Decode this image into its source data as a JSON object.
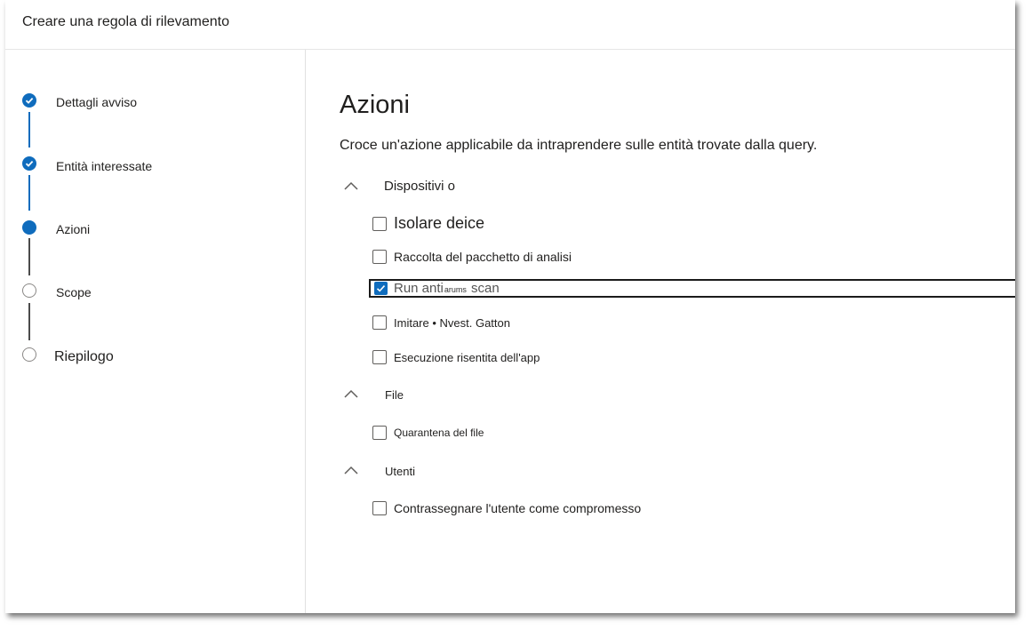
{
  "header": {
    "title": "Creare una regola di rilevamento"
  },
  "steps": [
    {
      "label": "Dettagli avviso",
      "state": "done"
    },
    {
      "label": "Entità interessate",
      "state": "done"
    },
    {
      "label": "Azioni",
      "state": "current"
    },
    {
      "label": "Scope",
      "state": "pending"
    },
    {
      "label": "Riepilogo",
      "state": "pending"
    }
  ],
  "main": {
    "title": "Azioni",
    "description": "Croce un'azione applicabile da intraprendere sulle entità trovate dalla query.",
    "sections": [
      {
        "label": "Dispositivi o",
        "items": [
          {
            "label": "Isolare deice",
            "checked": false
          },
          {
            "label": "Raccolta del pacchetto di analisi",
            "checked": false
          },
          {
            "label_pre": "Run anti",
            "label_tiny": "arums",
            "label_post": " scan",
            "checked": true
          },
          {
            "label": "Imitare • Nvest. Gatton",
            "checked": false
          },
          {
            "label": "Esecuzione risentita dell'app",
            "checked": false
          }
        ]
      },
      {
        "label": "File",
        "items": [
          {
            "label": "Quarantena del file",
            "checked": false
          }
        ]
      },
      {
        "label": "Utenti",
        "items": [
          {
            "label": "Contrassegnare l'utente come compromesso",
            "checked": false
          }
        ]
      }
    ]
  },
  "colors": {
    "accent": "#0f6cbd",
    "text": "#201f1e",
    "pending": "#8a8886"
  },
  "icons": {
    "step_done": "checkmark-icon",
    "section": "chevron-up-icon"
  }
}
